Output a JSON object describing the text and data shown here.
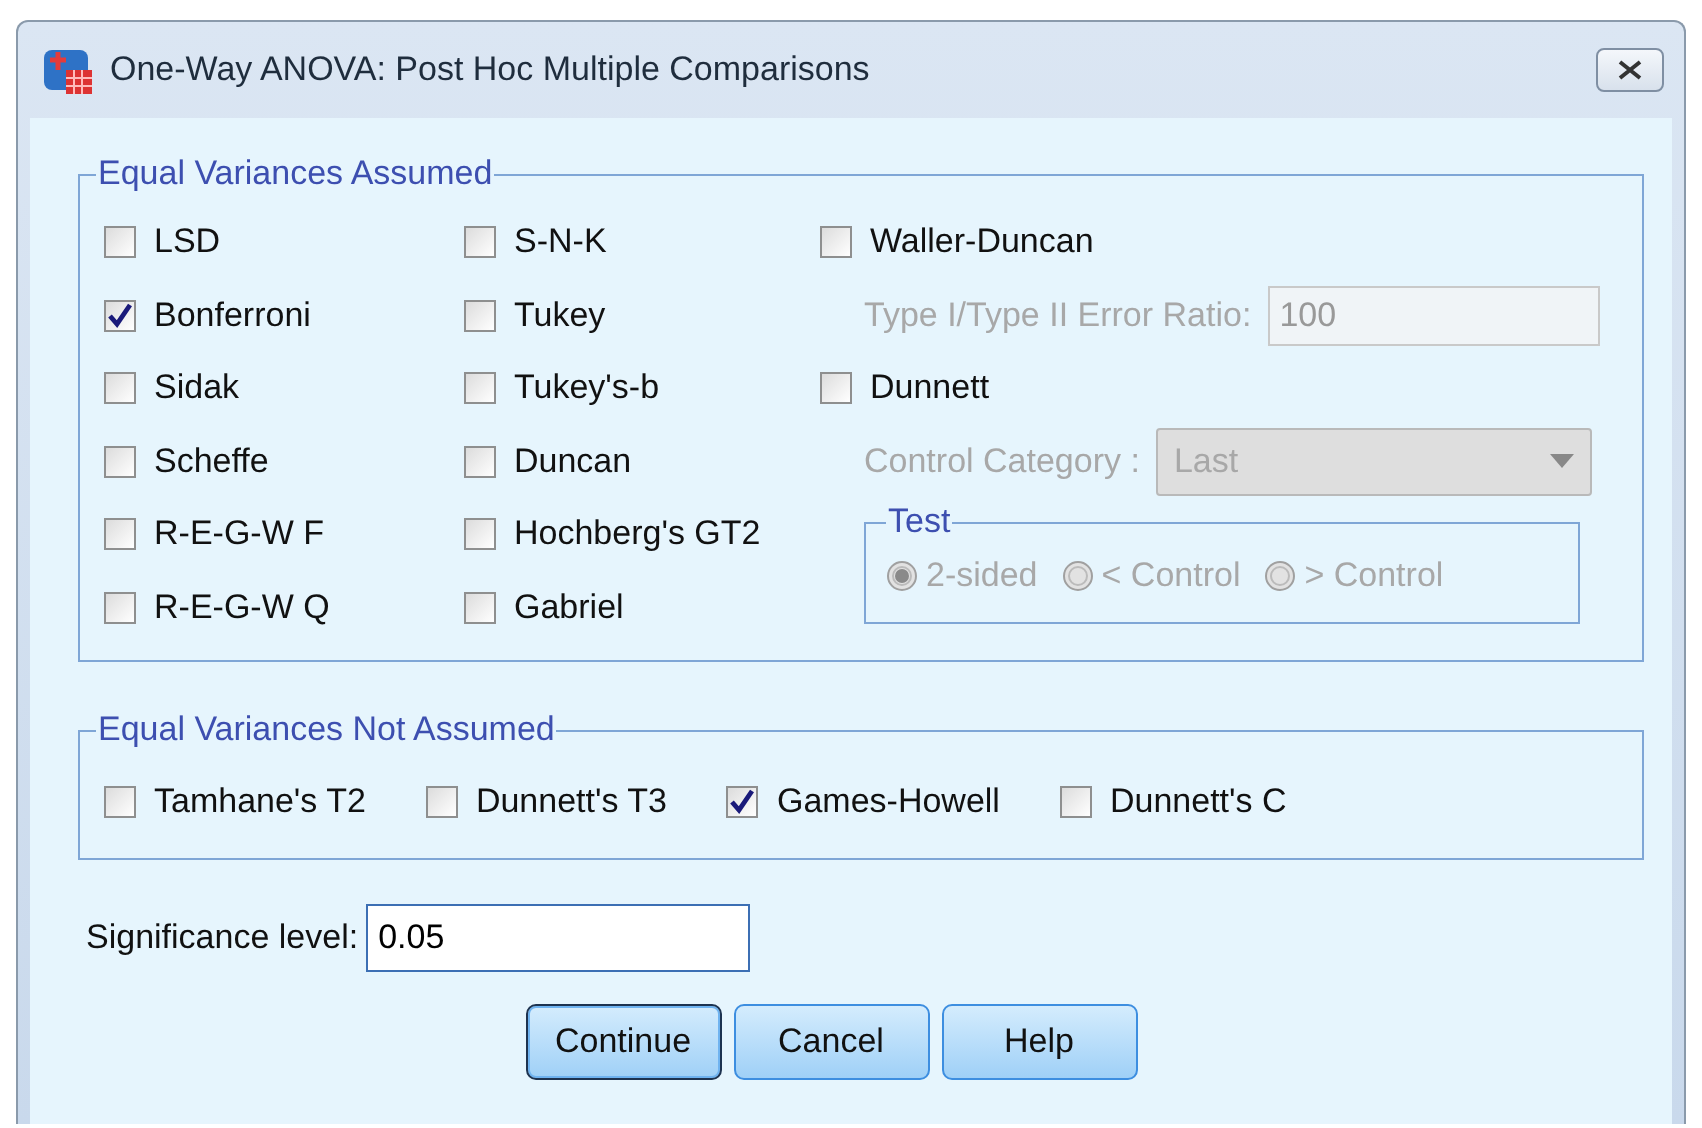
{
  "window": {
    "title": "One-Way ANOVA: Post Hoc Multiple Comparisons"
  },
  "assumed": {
    "title": "Equal Variances Assumed",
    "columns": [
      [
        {
          "label": "LSD",
          "checked": false
        },
        {
          "label": "Bonferroni",
          "checked": true
        },
        {
          "label": "Sidak",
          "checked": false
        },
        {
          "label": "Scheffe",
          "checked": false
        },
        {
          "label": "R-E-G-W F",
          "checked": false
        },
        {
          "label": "R-E-G-W Q",
          "checked": false
        }
      ],
      [
        {
          "label": "S-N-K",
          "checked": false
        },
        {
          "label": "Tukey",
          "checked": false
        },
        {
          "label": "Tukey's-b",
          "checked": false
        },
        {
          "label": "Duncan",
          "checked": false
        },
        {
          "label": "Hochberg's GT2",
          "checked": false
        },
        {
          "label": "Gabriel",
          "checked": false
        }
      ]
    ],
    "waller_duncan": {
      "label": "Waller-Duncan",
      "checked": false
    },
    "error_ratio": {
      "label": "Type I/Type II Error Ratio:",
      "value": "100",
      "disabled": true
    },
    "dunnett": {
      "label": "Dunnett",
      "checked": false
    },
    "control_category": {
      "label": "Control Category :",
      "value": "Last",
      "disabled": true
    },
    "test": {
      "title": "Test",
      "disabled": true,
      "options": [
        {
          "label": "2-sided",
          "selected": true
        },
        {
          "label": "< Control",
          "selected": false
        },
        {
          "label": "> Control",
          "selected": false
        }
      ]
    }
  },
  "not_assumed": {
    "title": "Equal Variances Not Assumed",
    "checks": [
      {
        "label": "Tamhane's T2",
        "checked": false
      },
      {
        "label": "Dunnett's T3",
        "checked": false
      },
      {
        "label": "Games-Howell",
        "checked": true
      },
      {
        "label": "Dunnett's C",
        "checked": false
      }
    ]
  },
  "significance": {
    "label": "Significance level:",
    "value": "0.05"
  },
  "buttons": [
    {
      "label": "Continue",
      "default": true
    },
    {
      "label": "Cancel",
      "default": false
    },
    {
      "label": "Help",
      "default": false
    }
  ]
}
